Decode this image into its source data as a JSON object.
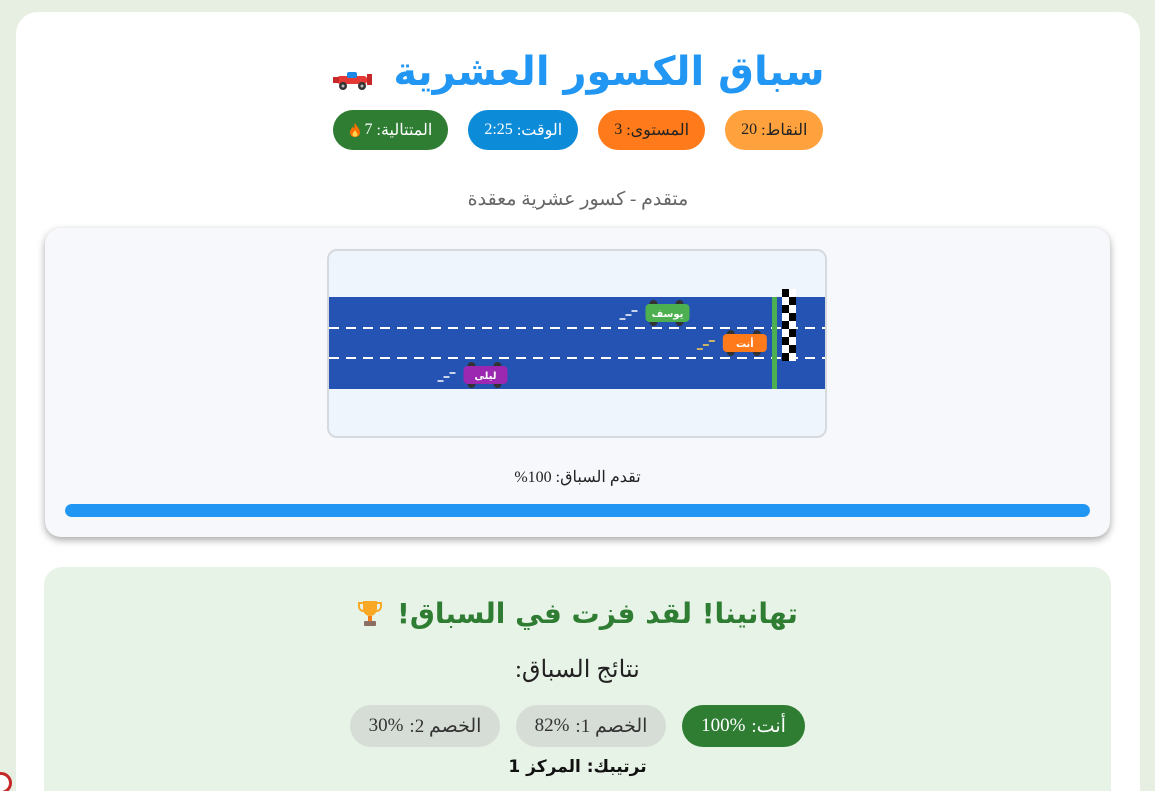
{
  "game": {
    "title": "سباق الكسور العشرية",
    "title_icon": "race-car-icon"
  },
  "stats": {
    "score_label": "النقاط:",
    "score_value": "20",
    "level_label": "المستوى:",
    "level_value": "3",
    "time_label": "الوقت:",
    "time_value": "2:25",
    "streak_label": "المتتالية:",
    "streak_value": "7",
    "streak_icon": "fire-icon"
  },
  "subtitle": "متقدم - كسور عشرية معقدة",
  "race": {
    "cars": [
      {
        "name": "أنت",
        "color": "#ff7a1a",
        "progress": 0.87,
        "lane": 2
      },
      {
        "name": "يوسف",
        "color": "#4caf50",
        "progress": 0.7,
        "lane": 1
      },
      {
        "name": "ليلى",
        "color": "#9c27b0",
        "progress": 0.3,
        "lane": 3
      }
    ],
    "progress_label": "تقدم السباق: 100%",
    "progress": 1.0
  },
  "colors": {
    "accent": "#2196f3",
    "win_green": "#2e7d32",
    "road": "#2553b4"
  },
  "result": {
    "win_text": "تهانينا! لقد فزت في السباق!",
    "win_icon": "trophy-icon",
    "results_title": "نتائج السباق:",
    "entries": [
      {
        "label": "أنت:",
        "value": "100%"
      },
      {
        "label": "الخصم 1:",
        "value": "82%"
      },
      {
        "label": "الخصم 2:",
        "value": "30%"
      }
    ],
    "rank_label": "ترتيبك:",
    "rank_value": "المركز 1"
  }
}
